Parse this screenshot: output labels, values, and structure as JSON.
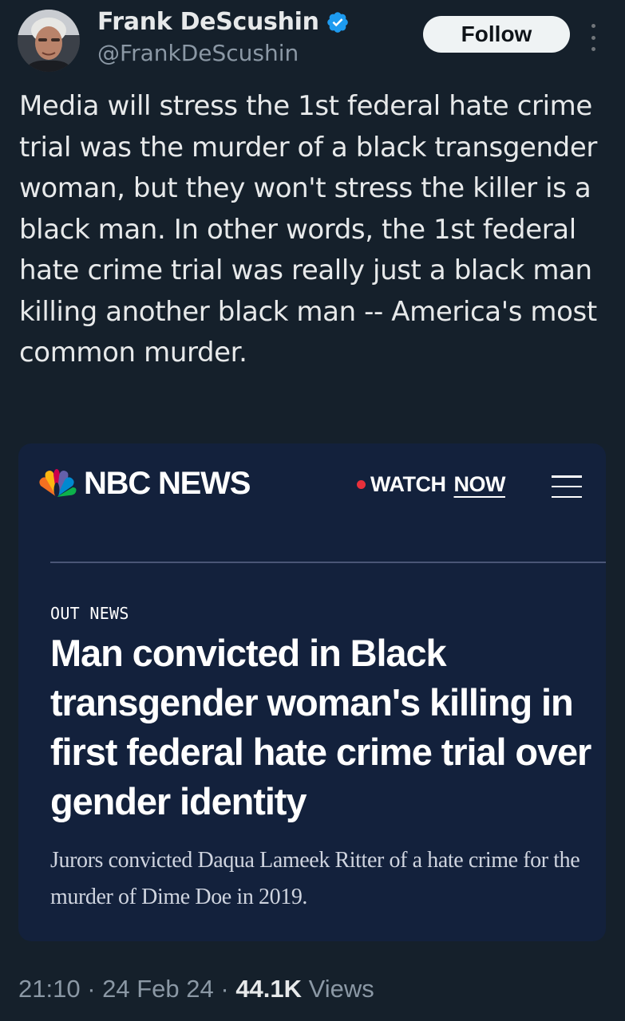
{
  "author": {
    "display_name": "Frank DeScushin",
    "handle": "@FrankDeScushin",
    "verified_icon": "verified-badge-icon",
    "follow_label": "Follow"
  },
  "tweet": {
    "text": "Media will stress the 1st federal hate crime trial was the murder of a black transgender woman, but they won't stress the killer is a black man. In other words, the 1st federal hate crime trial was really just a black man killing another black man -- America's most common murder."
  },
  "card": {
    "brand": "NBC NEWS",
    "watch_label": "WATCH",
    "now_label": "NOW",
    "section": "OUT NEWS",
    "headline": "Man convicted in Black transgender woman's killing in first federal hate crime trial over gender identity",
    "dek": "Jurors convicted Daqua Lameek Ritter of a hate crime for the murder of Dime Doe in 2019."
  },
  "meta": {
    "time": "21:10",
    "separator": " · ",
    "date": "24 Feb 24",
    "views_count": "44.1K",
    "views_label": " Views"
  },
  "colors": {
    "background": "#15202b",
    "card_background": "#13213c",
    "verified_blue": "#1d9bf0",
    "live_red": "#e8303b"
  }
}
